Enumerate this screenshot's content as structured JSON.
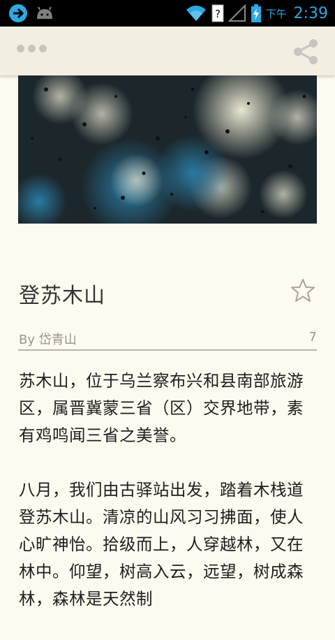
{
  "status_bar": {
    "ampm": "下午",
    "time": "2:39",
    "icons": [
      "arrow-right-circle-icon",
      "android-icon",
      "wifi-icon",
      "sim-unknown-icon",
      "signal-icon",
      "battery-charging-icon"
    ]
  },
  "action_bar": {
    "menu_icon": "more-dots-icon",
    "share_icon": "share-icon"
  },
  "article": {
    "title": "登苏木山",
    "author": "By 岱青山",
    "count": "7",
    "paragraphs": [
      "苏木山，位于乌兰察布兴和县南部旅游区，属晋冀蒙三省（区）交界地带，素有鸡鸣闻三省之美誉。",
      "八月，我们由古驿站出发，踏着木栈道登苏木山。清凉的山风习习拂面，使人心旷神怡。拾级而上，人穿越林，又在林中。仰望，树高入云，远望，树成森林，森林是天然制"
    ]
  },
  "colors": {
    "status_accent": "#2ea8e0",
    "background": "#fdfaf0",
    "actionbar": "#f2eee2"
  }
}
